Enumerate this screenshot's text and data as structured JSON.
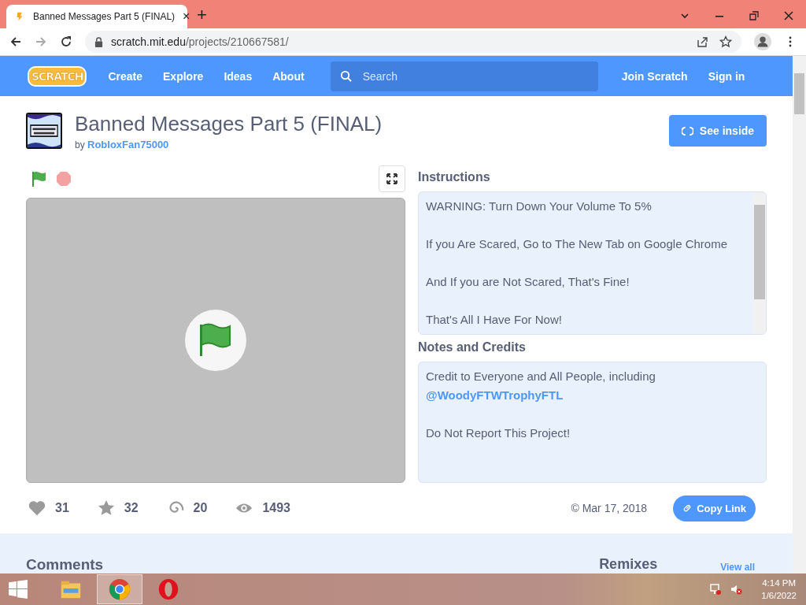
{
  "browser": {
    "tab": {
      "title": "Banned Messages Part 5 (FINAL)",
      "close": "×"
    },
    "new_tab": "+",
    "address": {
      "host": "scratch.mit.edu",
      "path": "/projects/210667581/"
    }
  },
  "nav": {
    "logo": "SCRATCH",
    "links": [
      "Create",
      "Explore",
      "Ideas",
      "About"
    ],
    "search": {
      "placeholder": "Search"
    },
    "join": "Join Scratch",
    "sign_in": "Sign in"
  },
  "project": {
    "title": "Banned Messages Part 5 (FINAL)",
    "by": "by",
    "author": "RobloxFan75000",
    "see_inside": "See inside"
  },
  "instructions": {
    "heading": "Instructions",
    "lines": [
      "WARNING: Turn Down Your Volume To 5%",
      "If you Are Scared, Go to The New Tab on Google Chrome",
      "And If you are Not Scared, That's Fine!",
      "That's All I Have For Now!"
    ]
  },
  "notes": {
    "heading": "Notes and Credits",
    "text": "Credit to Everyone and All People, including",
    "mention": "@WoodyFTWTrophyFTL",
    "closing": "Do Not Report This Project!"
  },
  "stats": [
    {
      "kind": "love",
      "count": "31"
    },
    {
      "kind": "favorite",
      "count": "32"
    },
    {
      "kind": "remix",
      "count": "20"
    },
    {
      "kind": "view",
      "count": "1493"
    }
  ],
  "date": "© Mar 17, 2018",
  "copy_link": "Copy Link",
  "lower": {
    "comments": "Comments",
    "remixes": "Remixes",
    "view_all": "View all"
  },
  "taskbar": {
    "apps": [
      {
        "kind": "explorer",
        "selected": false
      },
      {
        "kind": "chrome",
        "selected": true
      },
      {
        "kind": "opera",
        "selected": false
      }
    ],
    "time": "4:14 PM",
    "date": "1/6/2022"
  }
}
